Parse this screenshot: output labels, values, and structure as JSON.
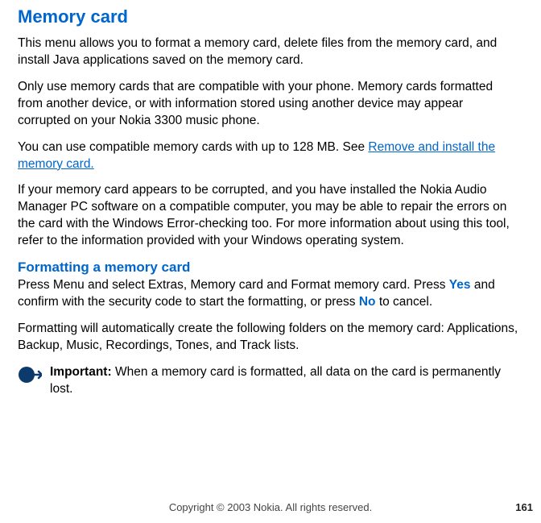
{
  "title": "Memory card",
  "paragraphs": {
    "p1": "This menu allows you to format a memory card, delete files from the memory card, and install Java applications saved on the memory card.",
    "p2": "Only use memory cards that are compatible with your phone. Memory cards formatted from another device, or with information stored using another device may appear corrupted on your Nokia 3300 music phone.",
    "p3_part1": "You can use compatible memory cards with up to 128 MB. See ",
    "p3_link": "Remove and install the memory card.",
    "p4": "If your memory card appears to be corrupted, and you have installed the Nokia Audio Manager PC software on a compatible computer, you may be able to repair the errors on the card with the Windows Error-checking too.  For more information about using this tool, refer to the information provided with your Windows operating system."
  },
  "subheading": "Formatting a memory card",
  "formatting": {
    "p5_part1": "Press Menu and select Extras, Memory card and Format memory card. Press ",
    "yes": "Yes",
    "p5_part2": " and confirm with the security code to start the formatting, or press ",
    "no": "No",
    "p5_part3": " to cancel.",
    "p6": "Formatting will automatically create the following folders on the memory card:  Applications, Backup, Music, Recordings, Tones, and Track lists."
  },
  "important": {
    "label": "Important:",
    "text": " When a memory card is formatted, all data on the card is permanently lost."
  },
  "footer": {
    "copyright": "Copyright © 2003 Nokia. All rights reserved.",
    "page": "161"
  }
}
